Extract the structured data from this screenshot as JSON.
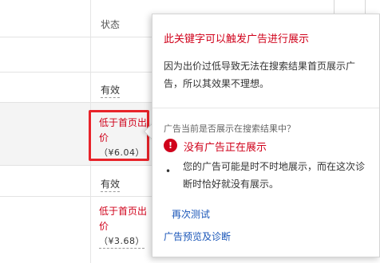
{
  "table": {
    "status_header": "状态",
    "rows": [
      {
        "status": "有效"
      },
      {
        "status_warning": "低于首页出价",
        "price": "（¥6.04）"
      },
      {
        "status": "有效"
      },
      {
        "status_warning": "低于首页出价",
        "price": "（¥3.68）"
      }
    ]
  },
  "popover": {
    "title": "此关键字可以触发广告进行展示",
    "description": "因为出价过低导致无法在搜索结果首页展示广告，所以其效果不理想。",
    "question": "广告当前是否展示在搜索结果中？",
    "error_icon_glyph": "!",
    "error_label": "没有广告正在展示",
    "bullet_glyph": "•",
    "bullet_text": "您的广告可能是时不时地展示，而在这次诊断时恰好就没有展示。",
    "retest_link": "再次测试",
    "preview_link": "广告预览及诊断"
  },
  "colors": {
    "warning_red": "#d0021b",
    "link_blue": "#1a56b8",
    "highlight_border": "#e8232a"
  }
}
